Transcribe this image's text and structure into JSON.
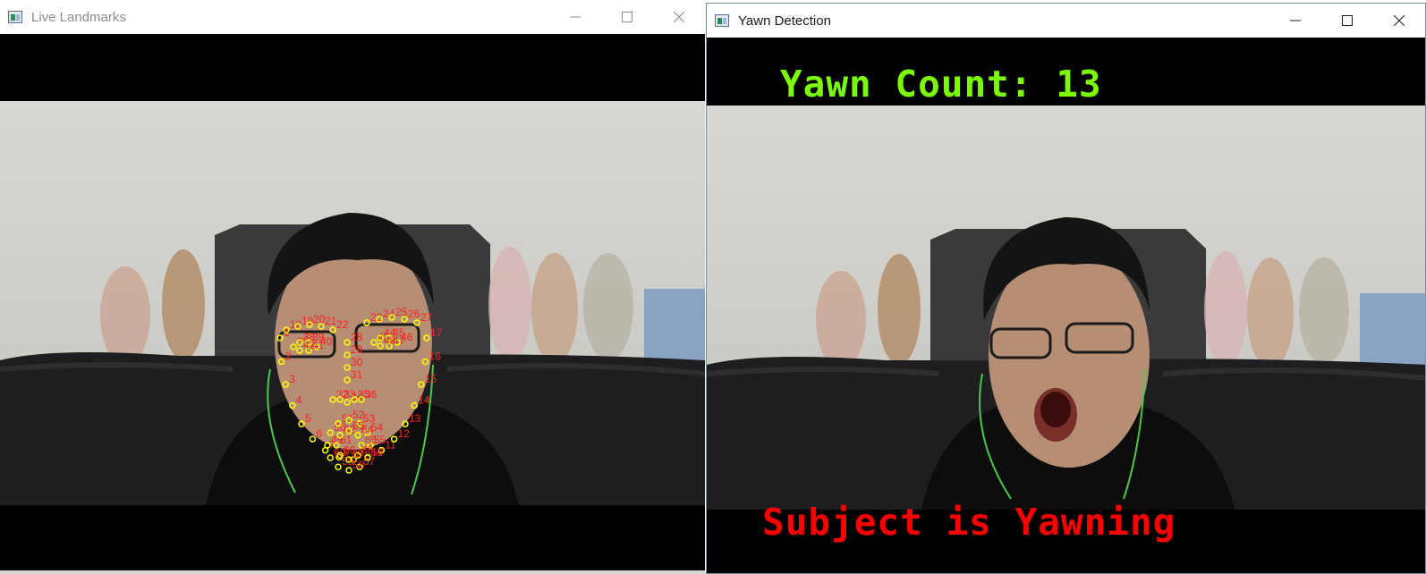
{
  "left_window": {
    "title": "Live Landmarks",
    "icon": "app-window-icon",
    "controls": [
      "minimize-icon",
      "maximize-icon",
      "close-icon"
    ],
    "landmark_labels": [
      "1",
      "2",
      "3",
      "4",
      "5",
      "6",
      "7",
      "8",
      "9",
      "10",
      "11",
      "12",
      "13",
      "14",
      "15",
      "16",
      "17",
      "18",
      "19",
      "20",
      "21",
      "22",
      "23",
      "24",
      "25",
      "26",
      "27",
      "28",
      "29",
      "30",
      "31",
      "32",
      "33",
      "34",
      "35",
      "36",
      "37",
      "38",
      "39",
      "40",
      "41",
      "42",
      "43",
      "44",
      "45",
      "46",
      "47",
      "48",
      "49",
      "50",
      "51",
      "52",
      "53",
      "54",
      "55",
      "56",
      "57",
      "58",
      "59",
      "60",
      "61",
      "62",
      "63",
      "64",
      "65",
      "66",
      "67",
      "68"
    ],
    "landmark_color": "#ffff00",
    "label_color": "#ff0000"
  },
  "right_window": {
    "title": "Yawn Detection",
    "icon": "app-window-icon",
    "controls": [
      "minimize-icon",
      "maximize-icon",
      "close-icon"
    ],
    "yawn_count_text": "Yawn Count: 13",
    "status_text": "Subject is Yawning",
    "yawn_count_color": "#7CFC00",
    "status_color": "#ff0000"
  }
}
